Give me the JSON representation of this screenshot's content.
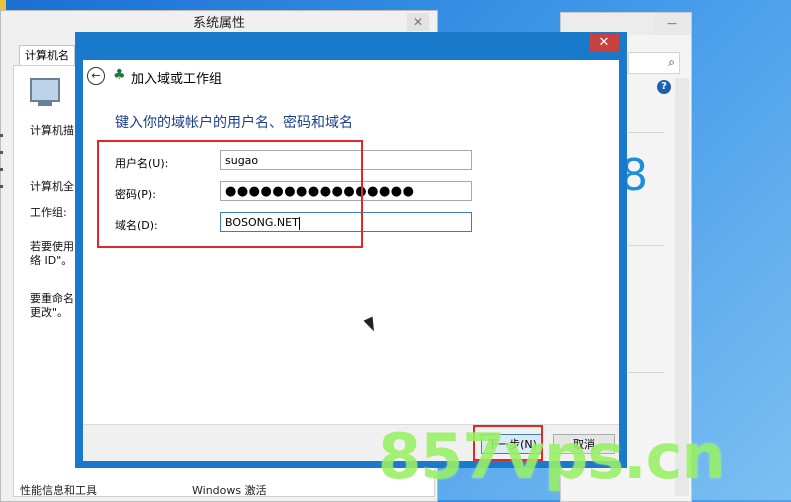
{
  "background_window": {
    "search_icon": "search-icon",
    "help_icon": "help-icon",
    "help_text": "?",
    "partial_text": "8"
  },
  "system_properties": {
    "title": "系统属性",
    "close_label": "✕",
    "tab_computer_name": "计算机名",
    "computer_description": "计算机描",
    "full_computer_name": "计算机全",
    "workgroup": "工作组:",
    "network_id_text": "若要使用\n络 ID\"。",
    "rename_text": "要重命名\n更改\"。",
    "bottom_left": "性能信息和工具",
    "bottom_mid": "Windows 激活"
  },
  "dialog": {
    "close_label": "✕",
    "back_icon": "back-arrow-icon",
    "back_glyph": "←",
    "wizard_icon": "network-wizard-icon",
    "wizard_glyph": "♣",
    "title": "加入域或工作组",
    "instruction": "键入你的域帐户的用户名、密码和域名",
    "username_label": "用户名(U):",
    "username_value": "sugao",
    "password_label": "密码(P):",
    "password_value": "●●●●●●●●●●●●●●●●",
    "domain_label": "域名(D):",
    "domain_value": "BOSONG.NET",
    "next_button": "下一步(N)",
    "cancel_button": "取消"
  },
  "watermark": "857vps.cn",
  "colors": {
    "dialog_frame": "#1979ca",
    "highlight": "#e02828",
    "instruction": "#1b3f8a",
    "watermark": "#90ee5a"
  }
}
